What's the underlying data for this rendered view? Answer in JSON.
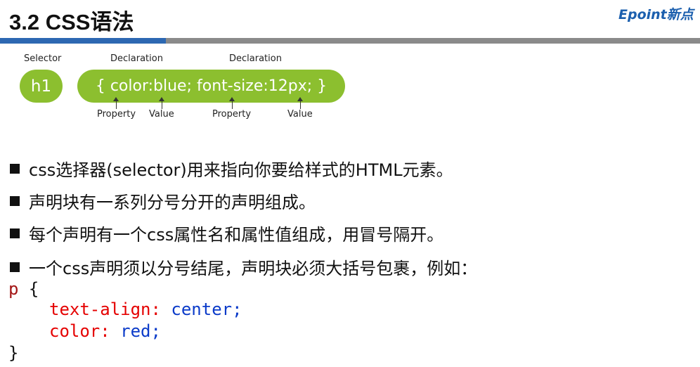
{
  "slide": {
    "title": "3.2 CSS语法",
    "logo": "Epoint新点",
    "colors": {
      "accent_bar": "#2d68b2",
      "divider": "#8a8a8a",
      "pill": "#8cbf2f"
    }
  },
  "diagram": {
    "top_labels": {
      "selector": "Selector",
      "declaration_1": "Declaration",
      "declaration_2": "Declaration"
    },
    "selector_text": "h1",
    "declaration_text": "{ color:blue; font-size:12px; }",
    "bottom_labels": {
      "property_1": "Property",
      "value_1": "Value",
      "property_2": "Property",
      "value_2": "Value"
    }
  },
  "bullets": [
    "css选择器(selector)用来指向你要给样式的HTML元素。",
    "声明块有一系列分号分开的声明组成。",
    "每个声明有一个css属性名和属性值组成，用冒号隔开。",
    "一个css声明须以分号结尾，声明块必须大括号包裹，例如："
  ],
  "code": {
    "selector": "p",
    "open_brace": "{",
    "lines": [
      {
        "property": "text-align",
        "colon": ":",
        "value": "center",
        "semicolon": ";"
      },
      {
        "property": "color",
        "colon": ":",
        "value": "red",
        "semicolon": ";"
      }
    ],
    "close_brace": "}"
  }
}
